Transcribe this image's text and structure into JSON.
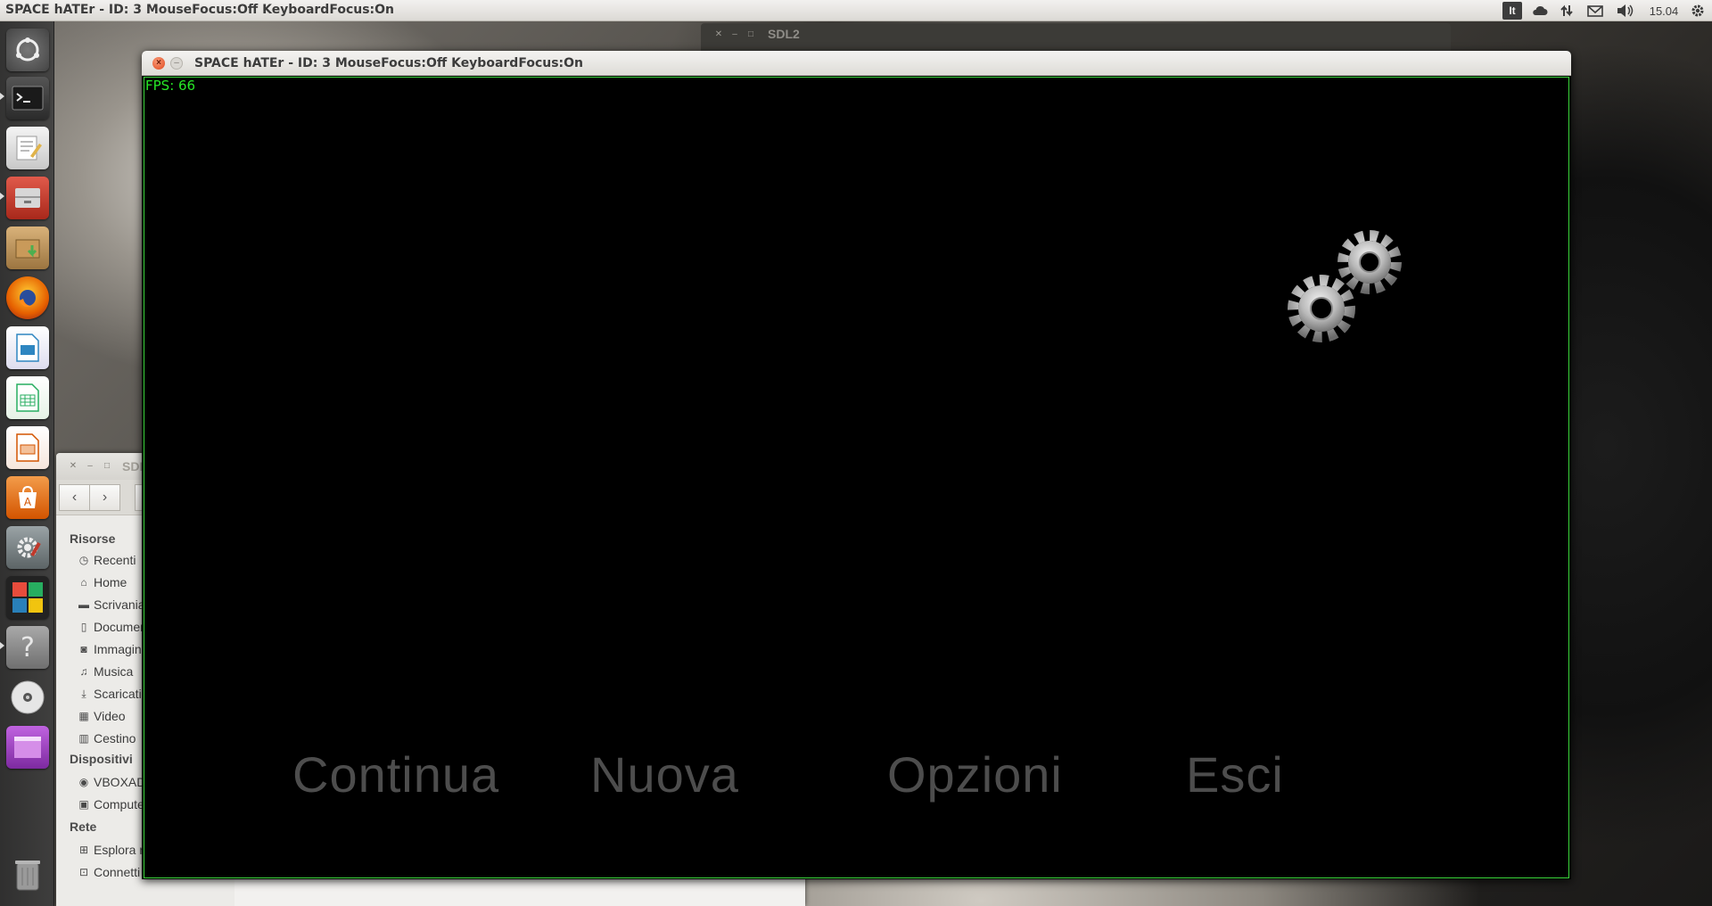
{
  "top_panel": {
    "window_title": "SPACE hATEr - ID: 3 MouseFocus:Off KeyboardFocus:On",
    "keyboard_layout": "It",
    "clock": "15.04"
  },
  "launcher": {
    "items": [
      {
        "name": "dash-home",
        "color": "#5a5a5a"
      },
      {
        "name": "terminal",
        "color": "#2b2b2b"
      },
      {
        "name": "text-editor",
        "color": "#d8d8d8"
      },
      {
        "name": "file-cabinet",
        "color": "#c0392b"
      },
      {
        "name": "archive-manager",
        "color": "#b58b4c"
      },
      {
        "name": "firefox",
        "color": "#e66000"
      },
      {
        "name": "libreoffice-draw",
        "color": "#2e86c1"
      },
      {
        "name": "libreoffice-calc",
        "color": "#27ae60"
      },
      {
        "name": "libreoffice-impress",
        "color": "#d35400"
      },
      {
        "name": "software-center",
        "color": "#e67e22"
      },
      {
        "name": "system-settings",
        "color": "#7f8c8d"
      },
      {
        "name": "workspace-switcher",
        "color": "#c0392b"
      },
      {
        "name": "help",
        "color": "#8a8a8a"
      },
      {
        "name": "dvd",
        "color": "#cfcfcf"
      },
      {
        "name": "sdl-app",
        "color": "#8e44ad"
      }
    ]
  },
  "sdl2_window": {
    "title": "SDL2"
  },
  "file_manager": {
    "title": "SDL",
    "sections": [
      {
        "label": "Risorse",
        "items": [
          {
            "label": "Recenti",
            "icon": "clock-icon"
          },
          {
            "label": "Home",
            "icon": "home-icon"
          },
          {
            "label": "Scrivania",
            "icon": "folder-icon"
          },
          {
            "label": "Documenti",
            "icon": "document-icon"
          },
          {
            "label": "Immagini",
            "icon": "camera-icon"
          },
          {
            "label": "Musica",
            "icon": "music-icon"
          },
          {
            "label": "Scaricati",
            "icon": "download-icon"
          },
          {
            "label": "Video",
            "icon": "film-icon"
          },
          {
            "label": "Cestino",
            "icon": "trash-icon"
          }
        ]
      },
      {
        "label": "Dispositivi",
        "items": [
          {
            "label": "VBOXADDITIONS",
            "icon": "disc-icon"
          },
          {
            "label": "Computer",
            "icon": "drive-icon"
          }
        ]
      },
      {
        "label": "Rete",
        "items": [
          {
            "label": "Esplora rete",
            "icon": "network-icon"
          },
          {
            "label": "Connetti a server",
            "icon": "server-icon"
          }
        ]
      }
    ]
  },
  "game_window": {
    "title": "SPACE hATEr - ID: 3 MouseFocus:Off KeyboardFocus:On",
    "fps_label": "FPS: 66",
    "menu": [
      "Continua",
      "Nuova",
      "Opzioni",
      "Esci"
    ],
    "accent_color": "#3bd63b"
  }
}
